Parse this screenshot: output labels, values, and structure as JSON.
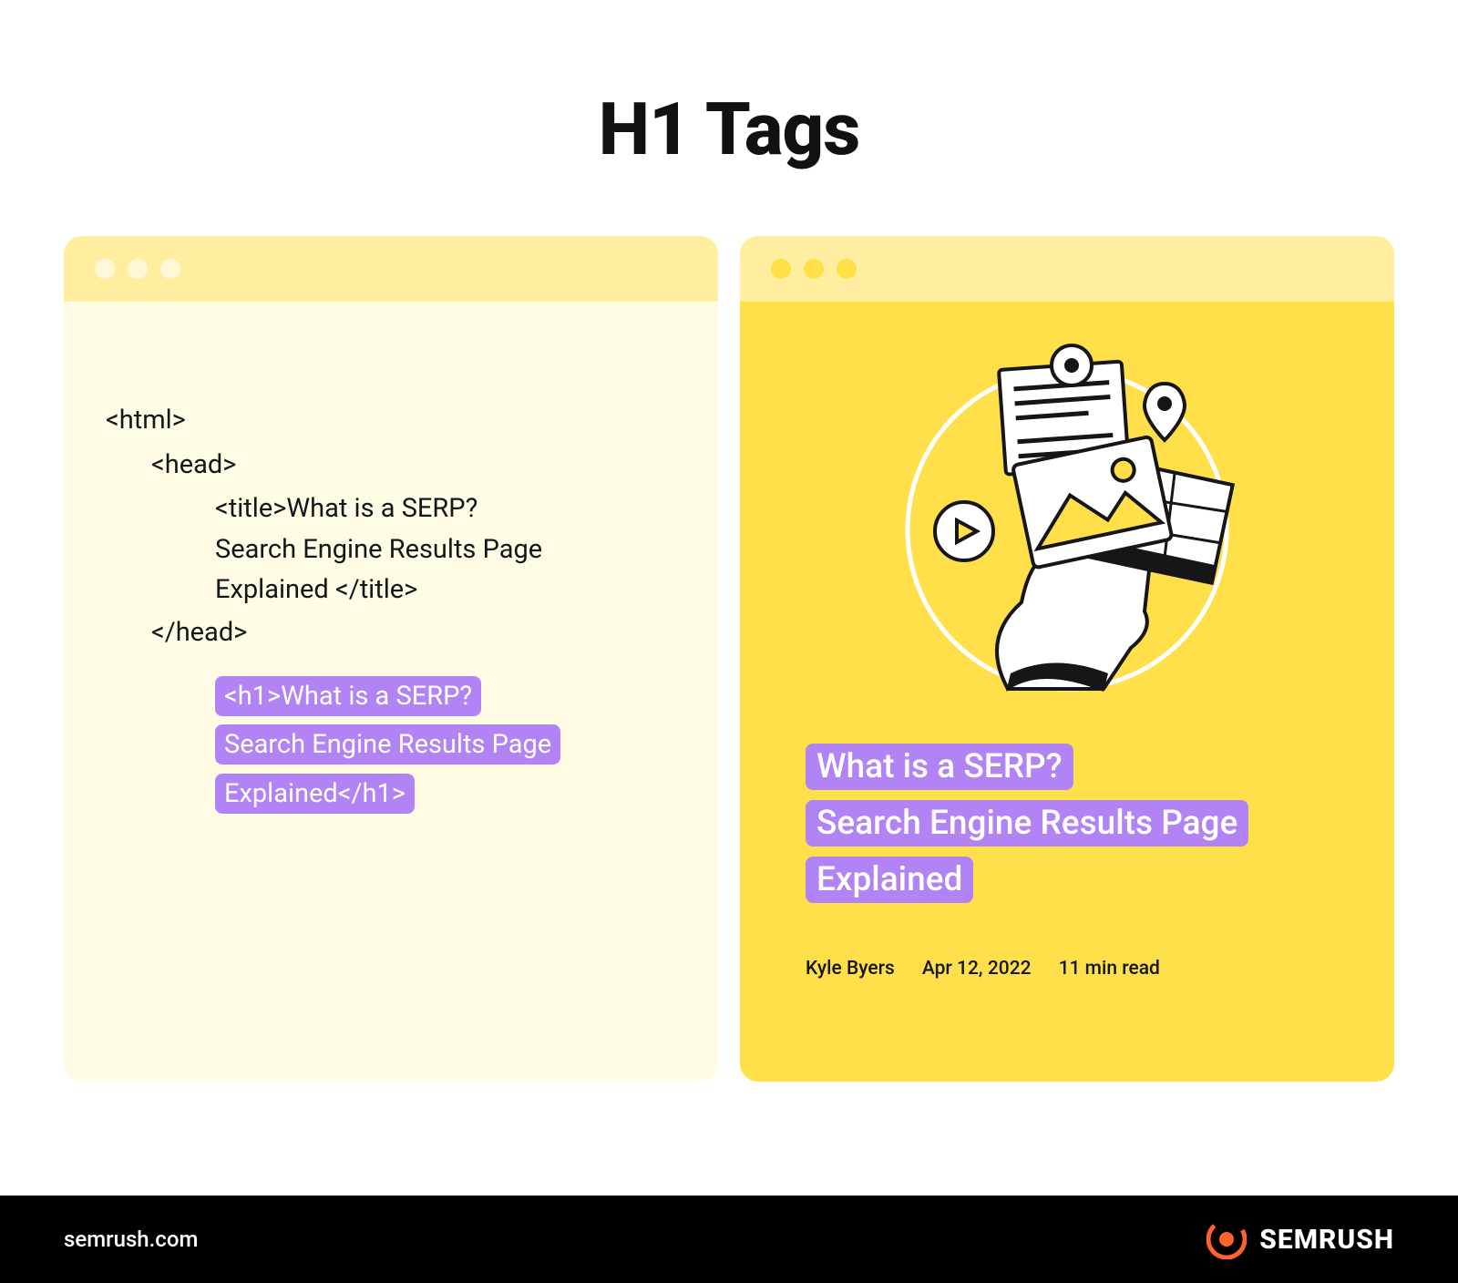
{
  "title": "H1 Tags",
  "code": {
    "html_open": "<html>",
    "head_open": "<head>",
    "title_open": "<title>",
    "title_text_1": "What is a SERP?",
    "title_text_2": "Search Engine Results Page",
    "title_text_3": "Explained ",
    "title_close": "</title>",
    "head_close": "</head>",
    "h1_open": "<h1>",
    "h1_text_1": "What is a SERP?",
    "h1_text_2": "Search Engine Results Page",
    "h1_text_3": "Explained",
    "h1_close": "</h1>"
  },
  "rendered": {
    "line1": "What is a SERP?",
    "line2": "Search Engine Results Page",
    "line3": "Explained"
  },
  "meta": {
    "author": "Kyle Byers",
    "date": "Apr 12, 2022",
    "readtime": "11 min read"
  },
  "footer": {
    "url": "semrush.com",
    "brand": "SEMRUSH"
  },
  "colors": {
    "highlight": "#b183f4",
    "yellow_bright": "#ffe04a",
    "yellow_pale": "#fffbe5",
    "yellow_header": "#ffeea0",
    "orange": "#ff622d"
  }
}
